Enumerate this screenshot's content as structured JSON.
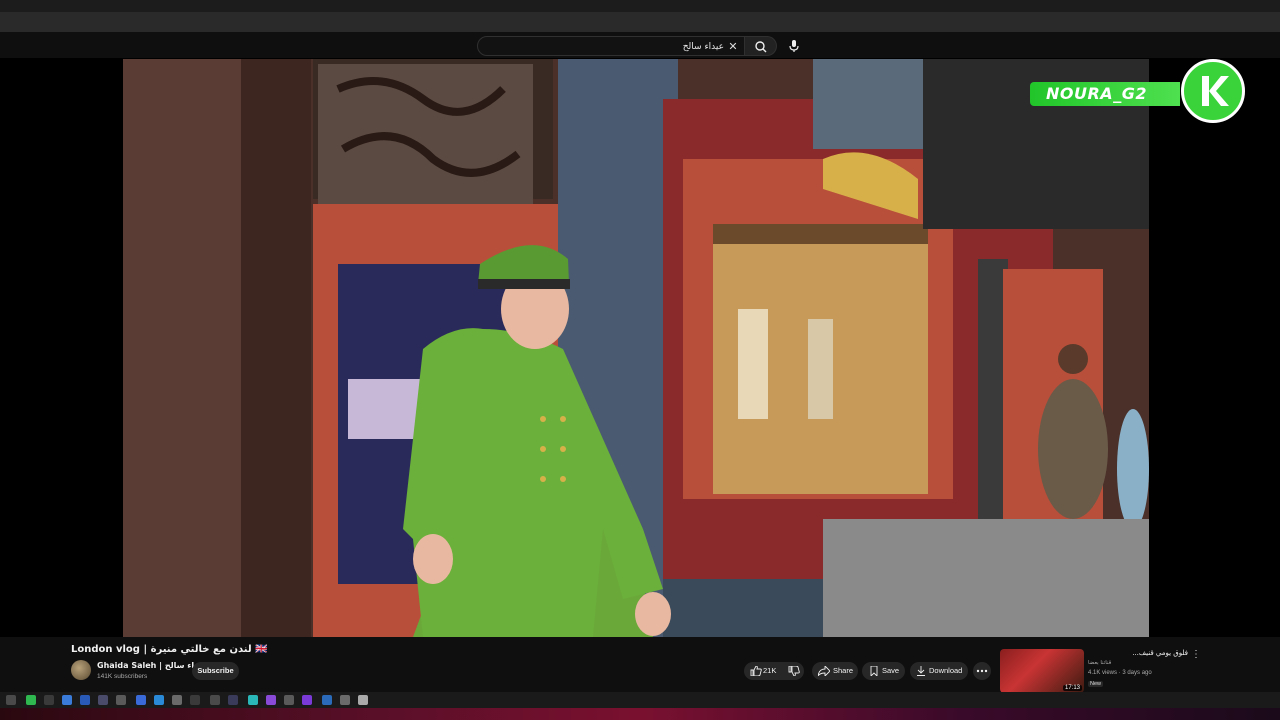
{
  "search": {
    "value": "عيداء سالح",
    "clear_icon": "close-icon",
    "button_icon": "search-icon",
    "mic_icon": "microphone-icon"
  },
  "watermark": {
    "text": "NOURA_G2",
    "logo_letter": "K",
    "color": "#2fd12f"
  },
  "video": {
    "title": "London vlog | لندن مع خالتي منيرة 🇬🇧",
    "channel": "Ghaida Saleh | عيداء سالح",
    "subscribers": "141K subscribers",
    "subscribe_label": "Subscribe"
  },
  "actions": {
    "likes": "21K",
    "share": "Share",
    "save": "Save",
    "download": "Download"
  },
  "recommended": {
    "title": "فلوق يومي قنيف...",
    "channel": "قناتنا بعضا",
    "meta": "4.1K views · 3 days ago",
    "badge": "New",
    "duration": "17:13"
  },
  "colors": {
    "background": "#0f0f0f",
    "accent_green": "#2fd12f",
    "pill": "#272727"
  }
}
